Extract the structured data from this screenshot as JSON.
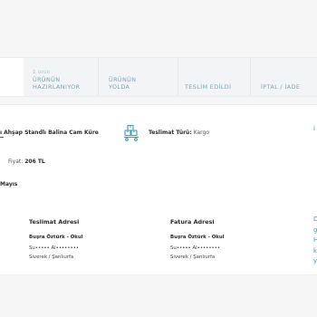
{
  "tabs": {
    "first": {
      "small": "",
      "label": ""
    },
    "prepared": {
      "small": "1 ürün",
      "line1": "ÜRÜNÜN",
      "line2": "HAZIRLANIYOR"
    },
    "shipping": {
      "line1": "ÜRÜNÜN",
      "line2": "YOLDA"
    },
    "delivered": {
      "label": "TESLİM EDİLDİ"
    },
    "cancel": {
      "label": "İPTAL / İADE"
    }
  },
  "order": {
    "product_name": "ı Ahşap Standlı Balina Cam Küre",
    "shipping_label": "Teslimat Türü:",
    "shipping_value": "Kargo",
    "price_label": "Fiyat:",
    "price_value": "206 TL",
    "date_fragment": "Mayıs",
    "edge_top": "i",
    "delivery_address": {
      "title": "Teslimat Adresi",
      "name": "Buşra Öztürk - Okul",
      "line2": "Su••••• Al••••••••",
      "line3": "Siverek / Şanlıurfa"
    },
    "billing_address": {
      "title": "Fatura Adresi",
      "name": "Buşra Öztürk - Okul",
      "line2": "Su••••• Al••••••••",
      "line3": "Siverek / Şanlıurfa"
    },
    "edge_links": [
      "D",
      "g",
      "H",
      "k",
      "y"
    ]
  },
  "icons": {
    "shipping": "delivery-boxes-icon"
  },
  "colors": {
    "accent": "#3aa0b8",
    "tab_text": "#7aa5b8",
    "background": "#f6f6f7"
  }
}
